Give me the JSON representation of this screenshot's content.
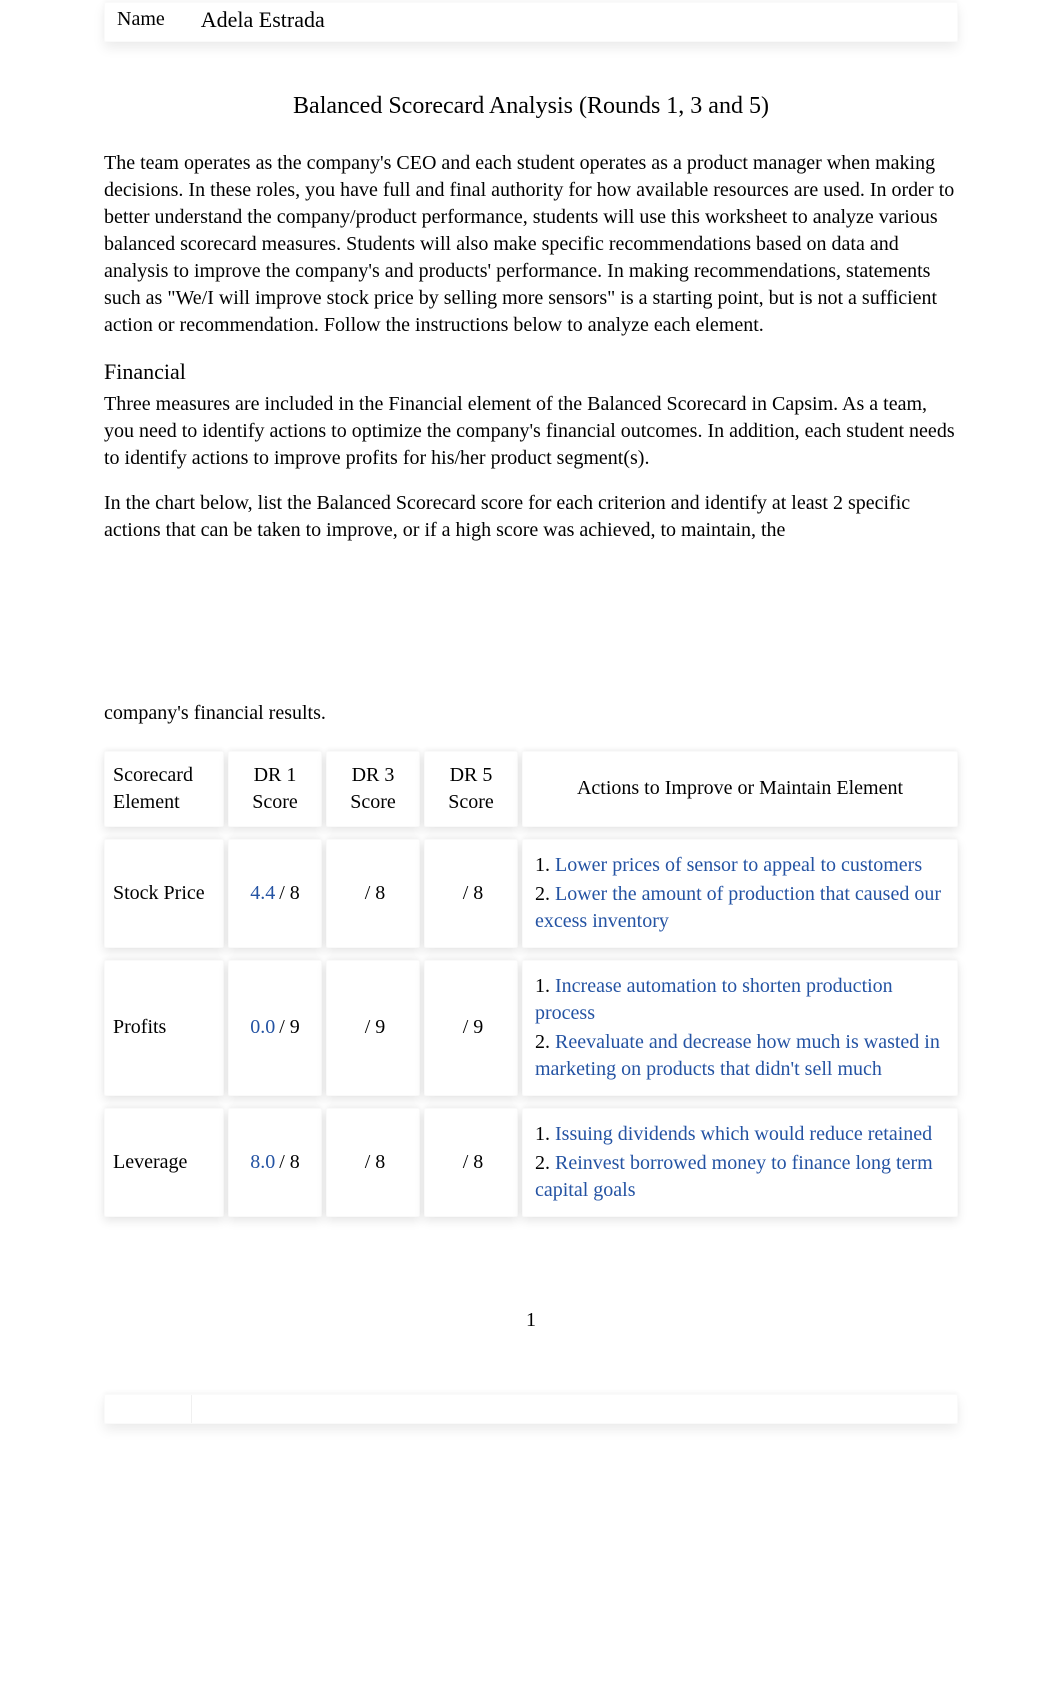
{
  "name_field": {
    "label": "Name",
    "value": "Adela Estrada"
  },
  "title": "Balanced Scorecard Analysis (Rounds 1, 3 and 5)",
  "intro": "The team operates as the company's CEO and each student operates as a product manager when making decisions.  In these roles, you have full and final authority for how available resources are used.   In order to better understand the company/product performance, students will use this worksheet to analyze various balanced scorecard measures.    Students will also make specific recommendations based on data and analysis to improve the company's and products' performance.   In making recommendations, statements such as \"We/I will improve stock price by selling more sensors\" is a starting point, but is not a sufficient action or recommendation.   Follow the instructions below to analyze each element.",
  "section_heading": "Financial",
  "financial_p1": "Three measures are included in the Financial element of the Balanced Scorecard in Capsim.   As a team, you need to identify actions to optimize the company's financial outcomes.    In addition, each student needs to identify actions to improve profits for his/her product segment(s).",
  "financial_p2": "In the chart below, list the Balanced Scorecard score for each criterion and identify at least 2 specific actions that can be taken to improve, or if a high score was achieved, to maintain, the",
  "financial_p2_continued": "company's financial results.",
  "table": {
    "headers": {
      "element": "Scorecard Element",
      "dr1": "DR 1 Score",
      "dr3": "DR 3 Score",
      "dr5": "DR 5 Score",
      "actions": "Actions to Improve or Maintain Element"
    },
    "rows": [
      {
        "element": "Stock Price",
        "dr1_value": "4.4",
        "dr1_max": "/ 8",
        "dr3_value": "",
        "dr3_max": "/ 8",
        "dr5_value": "",
        "dr5_max": "/ 8",
        "action1": "Lower prices of sensor to appeal to customers",
        "action2": "Lower the amount of production that caused our excess inventory"
      },
      {
        "element": "Profits",
        "dr1_value": "0.0",
        "dr1_max": " / 9",
        "dr3_value": "",
        "dr3_max": "/ 9",
        "dr5_value": "",
        "dr5_max": "/ 9",
        "action1": "Increase automation to shorten production process",
        "action2": "Reevaluate and decrease how much is wasted in marketing on products that didn't sell much"
      },
      {
        "element": "Leverage",
        "dr1_value": "8.0",
        "dr1_max": " / 8",
        "dr3_value": "",
        "dr3_max": "/ 8",
        "dr5_value": "",
        "dr5_max": "/ 8",
        "action1": "Issuing dividends which would reduce retained",
        "action2": "Reinvest borrowed money to finance long term capital goals"
      }
    ]
  },
  "page_number": "1",
  "chart_data": {
    "type": "table",
    "title": "Balanced Scorecard — Financial",
    "columns": [
      "Scorecard Element",
      "DR 1 Score",
      "DR 3 Score",
      "DR 5 Score"
    ],
    "rows": [
      {
        "element": "Stock Price",
        "dr1": 4.4,
        "dr1_max": 8,
        "dr3": null,
        "dr3_max": 8,
        "dr5": null,
        "dr5_max": 8
      },
      {
        "element": "Profits",
        "dr1": 0.0,
        "dr1_max": 9,
        "dr3": null,
        "dr3_max": 9,
        "dr5": null,
        "dr5_max": 9
      },
      {
        "element": "Leverage",
        "dr1": 8.0,
        "dr1_max": 8,
        "dr3": null,
        "dr3_max": 8,
        "dr5": null,
        "dr5_max": 8
      }
    ]
  }
}
